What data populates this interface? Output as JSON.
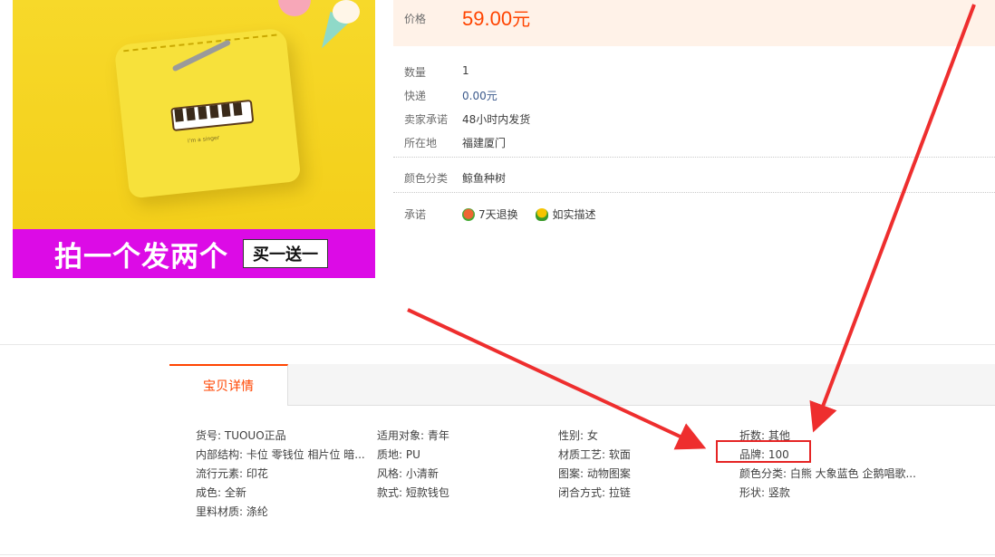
{
  "product": {
    "image_text": "i'm a singer",
    "banner_main": "拍一个发两个",
    "banner_tag": "买一送一"
  },
  "price": {
    "label": "价格",
    "amount": "59.00",
    "unit": "元"
  },
  "meta": {
    "quantity_label": "数量",
    "quantity_value": "1",
    "shipping_label": "快递",
    "shipping_value": "0.00元",
    "promise_label": "卖家承诺",
    "promise_value": "48小时内发货",
    "location_label": "所在地",
    "location_value": "福建厦门",
    "color_label": "颜色分类",
    "color_value": "鲸鱼种树",
    "commit_label": "承诺",
    "commit_items": [
      "7天退换",
      "如实描述"
    ]
  },
  "tabs": {
    "details": "宝贝详情"
  },
  "attributes": {
    "col1": [
      "货号: TUOUO正品",
      "内部结构: 卡位 零钱位 相片位 暗...",
      "流行元素: 印花",
      "成色: 全新",
      "里料材质: 涤纶"
    ],
    "col2": [
      "适用对象: 青年",
      "质地: PU",
      "风格: 小清新",
      "款式: 短款钱包"
    ],
    "col3": [
      "性别: 女",
      "材质工艺: 软面",
      "图案: 动物图案",
      "闭合方式: 拉链"
    ],
    "col4": [
      "折数: 其他",
      "品牌: 100",
      "颜色分类: 白熊 大象蓝色 企鹅唱歌...",
      "形状: 竖款"
    ]
  },
  "colors": {
    "accent": "#ff4400",
    "banner": "#dc0be6",
    "highlight": "#e52424"
  }
}
